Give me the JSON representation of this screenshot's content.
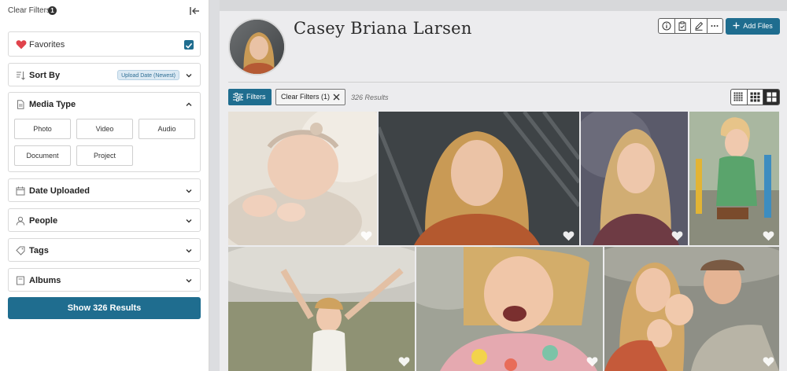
{
  "filter_panel": {
    "header_title": "Clear Filters",
    "header_badge": "1",
    "favorites_label": "Favorites",
    "sort_by_label": "Sort By",
    "sort_by_value": "Upload Date (Newest)",
    "media_type_label": "Media Type",
    "media_type_options": [
      "Photo",
      "Video",
      "Audio",
      "Document",
      "Project"
    ],
    "date_uploaded_label": "Date Uploaded",
    "people_label": "People",
    "tags_label": "Tags",
    "albums_label": "Albums",
    "show_results_label": "Show 326 Results"
  },
  "profile": {
    "name": "Casey Briana Larsen",
    "add_files_label": "Add Files"
  },
  "toolbar": {
    "filters_label": "Filters",
    "clear_filters_label": "Clear Filters (1)",
    "results_count": "326 Results"
  },
  "colors": {
    "accent": "#1f6d8f",
    "heart_red": "#e0434b"
  },
  "icons": {
    "toolbar_actions": [
      "info-icon",
      "clipboard-icon",
      "pencil-icon",
      "more-icon"
    ],
    "view_modes": [
      "grid-small-icon",
      "grid-medium-icon",
      "grid-large-icon"
    ]
  },
  "photos": [
    {
      "subject": "newborn"
    },
    {
      "subject": "portrait-teen"
    },
    {
      "subject": "portrait-girl"
    },
    {
      "subject": "toddler-playground"
    },
    {
      "subject": "child-field"
    },
    {
      "subject": "child-laughing"
    },
    {
      "subject": "family"
    }
  ]
}
